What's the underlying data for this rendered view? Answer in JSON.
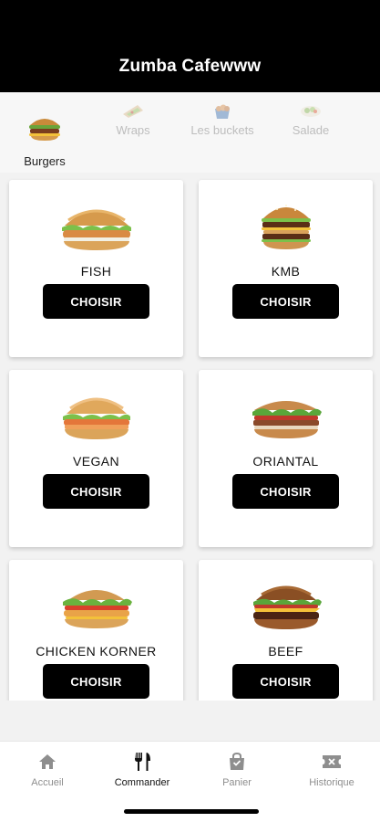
{
  "header": {
    "title": "Zumba Cafewww"
  },
  "categories": [
    {
      "label": "Burgers",
      "icon": "burger-icon",
      "active": true
    },
    {
      "label": "Wraps",
      "icon": "wrap-icon",
      "active": false
    },
    {
      "label": "Les buckets",
      "icon": "bucket-icon",
      "active": false
    },
    {
      "label": "Salade",
      "icon": "salad-icon",
      "active": false
    }
  ],
  "products": [
    {
      "name": "FISH",
      "button": "CHOISIR",
      "image": "fish-burger-image"
    },
    {
      "name": "KMB",
      "button": "CHOISIR",
      "image": "kmb-burger-image"
    },
    {
      "name": "VEGAN",
      "button": "CHOISIR",
      "image": "vegan-burger-image"
    },
    {
      "name": "ORIANTAL",
      "button": "CHOISIR",
      "image": "oriantal-burger-image"
    },
    {
      "name": "CHICKEN KORNER",
      "button": "CHOISIR",
      "image": "chicken-korner-burger-image"
    },
    {
      "name": "BEEF",
      "button": "CHOISIR",
      "image": "beef-burger-image"
    }
  ],
  "tabbar": {
    "items": [
      {
        "label": "Accueil",
        "icon": "home-icon",
        "active": false
      },
      {
        "label": "Commander",
        "icon": "fork-knife-icon",
        "active": true
      },
      {
        "label": "Panier",
        "icon": "bag-icon",
        "active": false
      },
      {
        "label": "Historique",
        "icon": "ticket-icon",
        "active": false
      }
    ]
  },
  "colors": {
    "header_bg": "#000000",
    "button_bg": "#000000",
    "button_text": "#ffffff",
    "tab_active": "#111111",
    "tab_inactive": "#8e8e8e"
  }
}
